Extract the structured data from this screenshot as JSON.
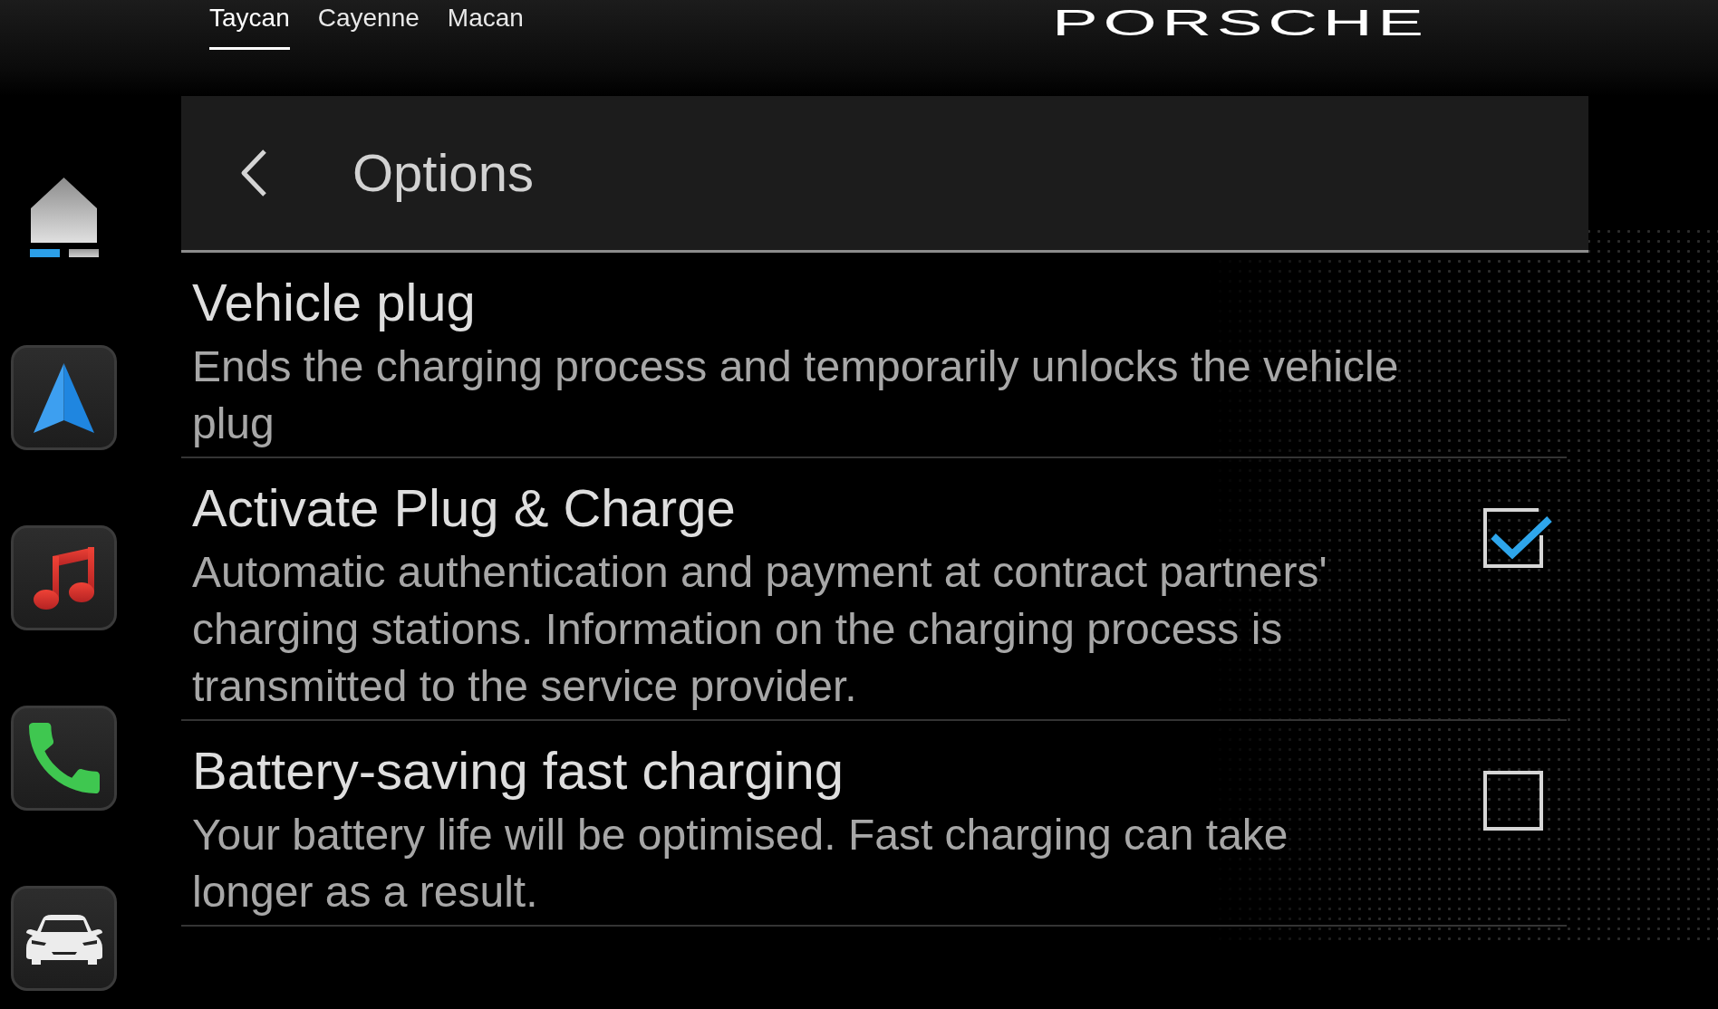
{
  "top_tabs": [
    {
      "label": "Taycan",
      "selected": true
    },
    {
      "label": "Cayenne",
      "selected": false
    },
    {
      "label": "Macan",
      "selected": false
    }
  ],
  "brand": {
    "logo_text": "PORSCHE"
  },
  "sidebar": {
    "page_indicator": [
      {
        "selected": true
      },
      {
        "selected": false
      }
    ],
    "apps": [
      {
        "kind": "navigation"
      },
      {
        "kind": "music"
      },
      {
        "kind": "phone"
      },
      {
        "kind": "vehicle"
      }
    ]
  },
  "header": {
    "title": "Options"
  },
  "options": [
    {
      "kind": "action",
      "title": "Vehicle plug",
      "description": "Ends the charging process and temporarily unlocks the vehicle plug"
    },
    {
      "kind": "checkbox",
      "title": "Activate Plug & Charge",
      "description": "Automatic authentication and payment at contract partners' charging stations. Information on the charging process is transmitted to the service provider.",
      "checked": true
    },
    {
      "kind": "checkbox",
      "title": "Battery-saving fast charging",
      "description": "Your battery life will be optimised. Fast charging can take longer as a result.",
      "checked": false
    }
  ]
}
